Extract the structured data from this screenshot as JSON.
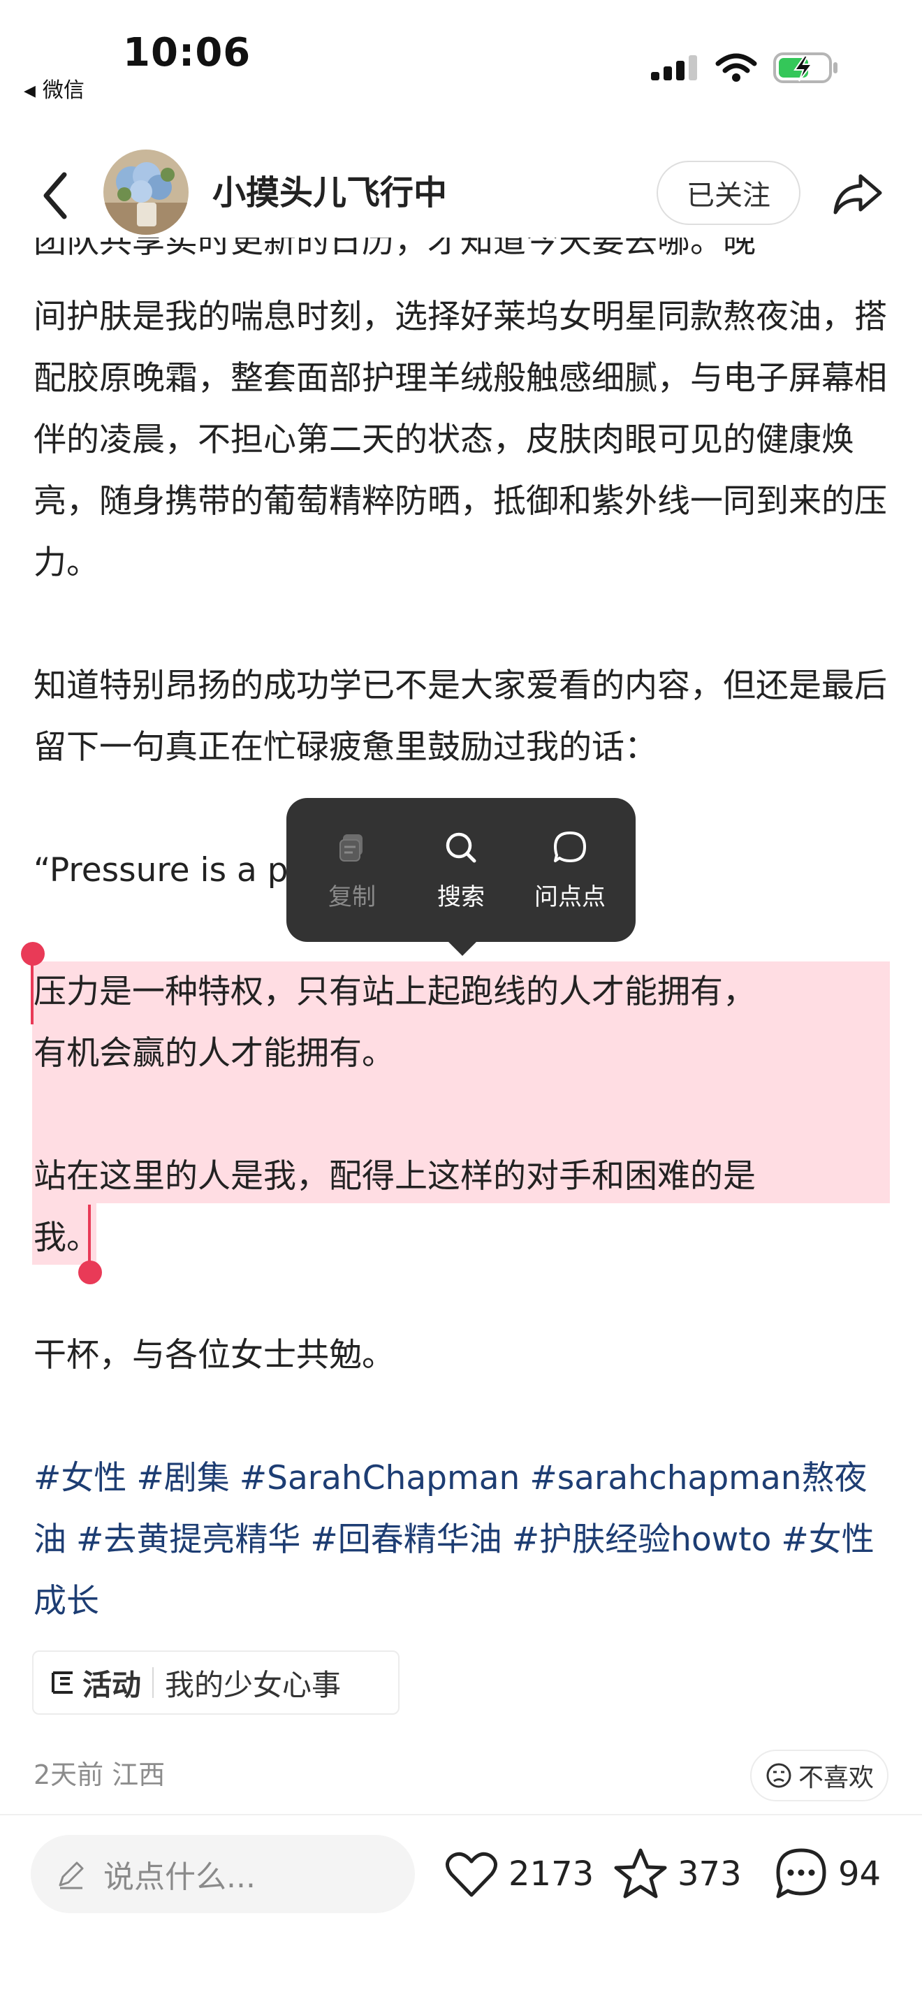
{
  "status_bar": {
    "time": "10:06",
    "back_app": "微信"
  },
  "header": {
    "username": "小摸头儿飞行中",
    "follow_label": "已关注"
  },
  "post": {
    "cut_line": "团队共享实时更新的日历，才知道今天要去哪。晚",
    "paragraph1": "间护肤是我的喘息时刻，选择好莱坞女明星同款熬夜油，搭配胶原晚霜，整套面部护理羊绒般触感细腻，与电子屏幕相伴的凌晨，不担心第二天的状态，皮肤肉眼可见的健康焕亮，随身携带的葡萄精粹防晒，抵御和紫外线一同到来的压力。",
    "paragraph2": "知道特别昂扬的成功学已不是大家爱看的内容，但还是最后留下一句真正在忙碌疲惫里鼓励过我的话：",
    "quote_en": "“Pressure is a privilege.”",
    "quote_cn_line1": "压力是一种特权，只有站上起跑线的人才能拥有，",
    "quote_cn_line2": "有机会赢的人才能拥有。",
    "quote_cn_line3": "站在这里的人是我，配得上这样的对手和困难的是",
    "quote_cn_line4": "我。",
    "closing": "干杯，与各位女士共勉。",
    "tags": [
      "#女性",
      "#剧集",
      "#SarahChapman",
      "#sarahchapman熬夜油",
      "#去黄提亮精华",
      "#回春精华油",
      "#护肤经验howto",
      "#女性成长"
    ]
  },
  "activity": {
    "label": "活动",
    "name": "我的少女心事"
  },
  "meta": {
    "time_location": "2天前 江西",
    "dislike_label": "不喜欢"
  },
  "popup": {
    "items": [
      {
        "label": "复制",
        "icon": "copy-icon"
      },
      {
        "label": "搜索",
        "icon": "search-icon"
      },
      {
        "label": "问点点",
        "icon": "chat-bubble-icon"
      }
    ]
  },
  "bottom_bar": {
    "comment_placeholder": "说点什么...",
    "likes": "2173",
    "collects": "373",
    "comments": "94"
  },
  "colors": {
    "selection_highlight": "#ffdde3",
    "selection_handle": "#e93a57",
    "tag_color": "#1d3d73",
    "popup_bg": "#333333"
  }
}
